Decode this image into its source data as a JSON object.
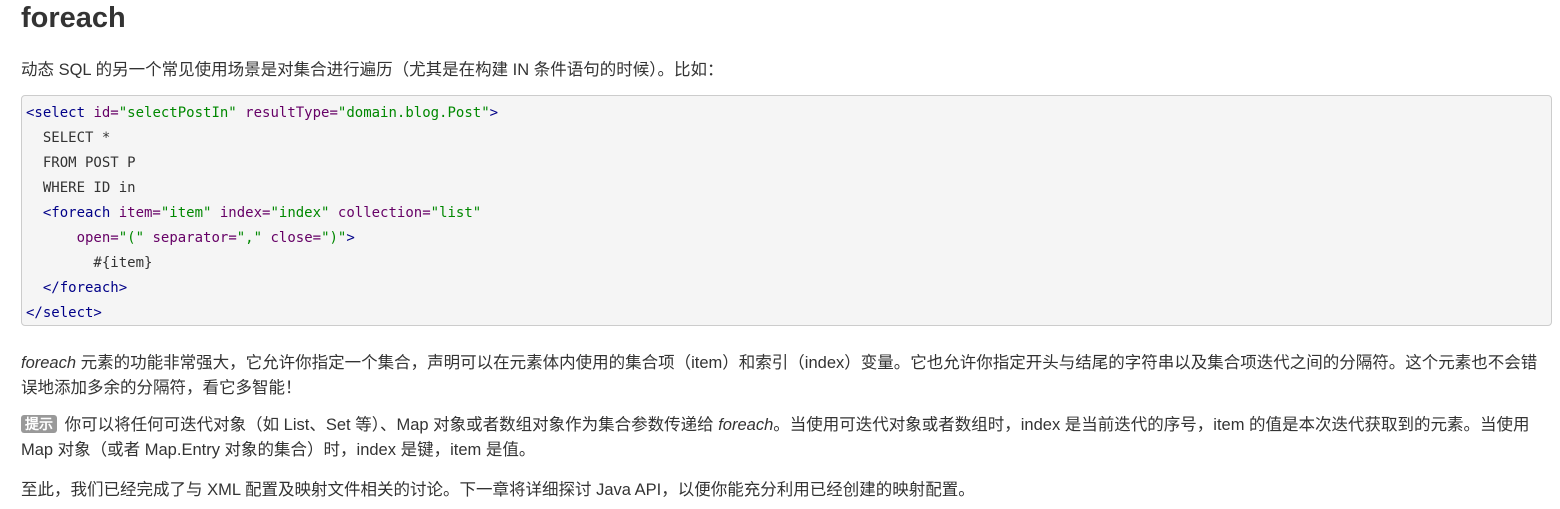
{
  "heading": "foreach",
  "intro": "动态 SQL 的另一个常见使用场景是对集合进行遍历（尤其是在构建 IN 条件语句的时候）。比如：",
  "code": {
    "line1_open": "<select ",
    "line1_attr1": "id=",
    "line1_val1": "\"selectPostIn\"",
    "line1_attr2": " resultType=",
    "line1_val2": "\"domain.blog.Post\"",
    "line1_close": ">",
    "line2": "  SELECT *",
    "line3": "  FROM POST P",
    "line4": "  WHERE ID in",
    "line5_open": "  <foreach ",
    "line5_attr1": "item=",
    "line5_val1": "\"item\"",
    "line5_attr2": " index=",
    "line5_val2": "\"index\"",
    "line5_attr3": " collection=",
    "line5_val3": "\"list\"",
    "line6_indent": "      ",
    "line6_attr1": "open=",
    "line6_val1": "\"(\"",
    "line6_attr2": " separator=",
    "line6_val2": "\",\"",
    "line6_attr3": " close=",
    "line6_val3": "\")\"",
    "line6_close": ">",
    "line7": "        #{item}",
    "line8": "  </foreach>",
    "line9": "</select>"
  },
  "para2": {
    "em": "foreach",
    "text": " 元素的功能非常强大，它允许你指定一个集合，声明可以在元素体内使用的集合项（item）和索引（index）变量。它也允许你指定开头与结尾的字符串以及集合项迭代之间的分隔符。这个元素也不会错误地添加多余的分隔符，看它多智能！"
  },
  "para3": {
    "badge": "提示",
    "text_before": " 你可以将任何可迭代对象（如 List、Set 等）、Map 对象或者数组对象作为集合参数传递给 ",
    "em": "foreach",
    "text_after": "。当使用可迭代对象或者数组时，index 是当前迭代的序号，item 的值是本次迭代获取到的元素。当使用 Map 对象（或者 Map.Entry 对象的集合）时，index 是键，item 是值。"
  },
  "para4": "至此，我们已经完成了与 XML 配置及映射文件相关的讨论。下一章将详细探讨 Java API，以便你能充分利用已经创建的映射配置。"
}
